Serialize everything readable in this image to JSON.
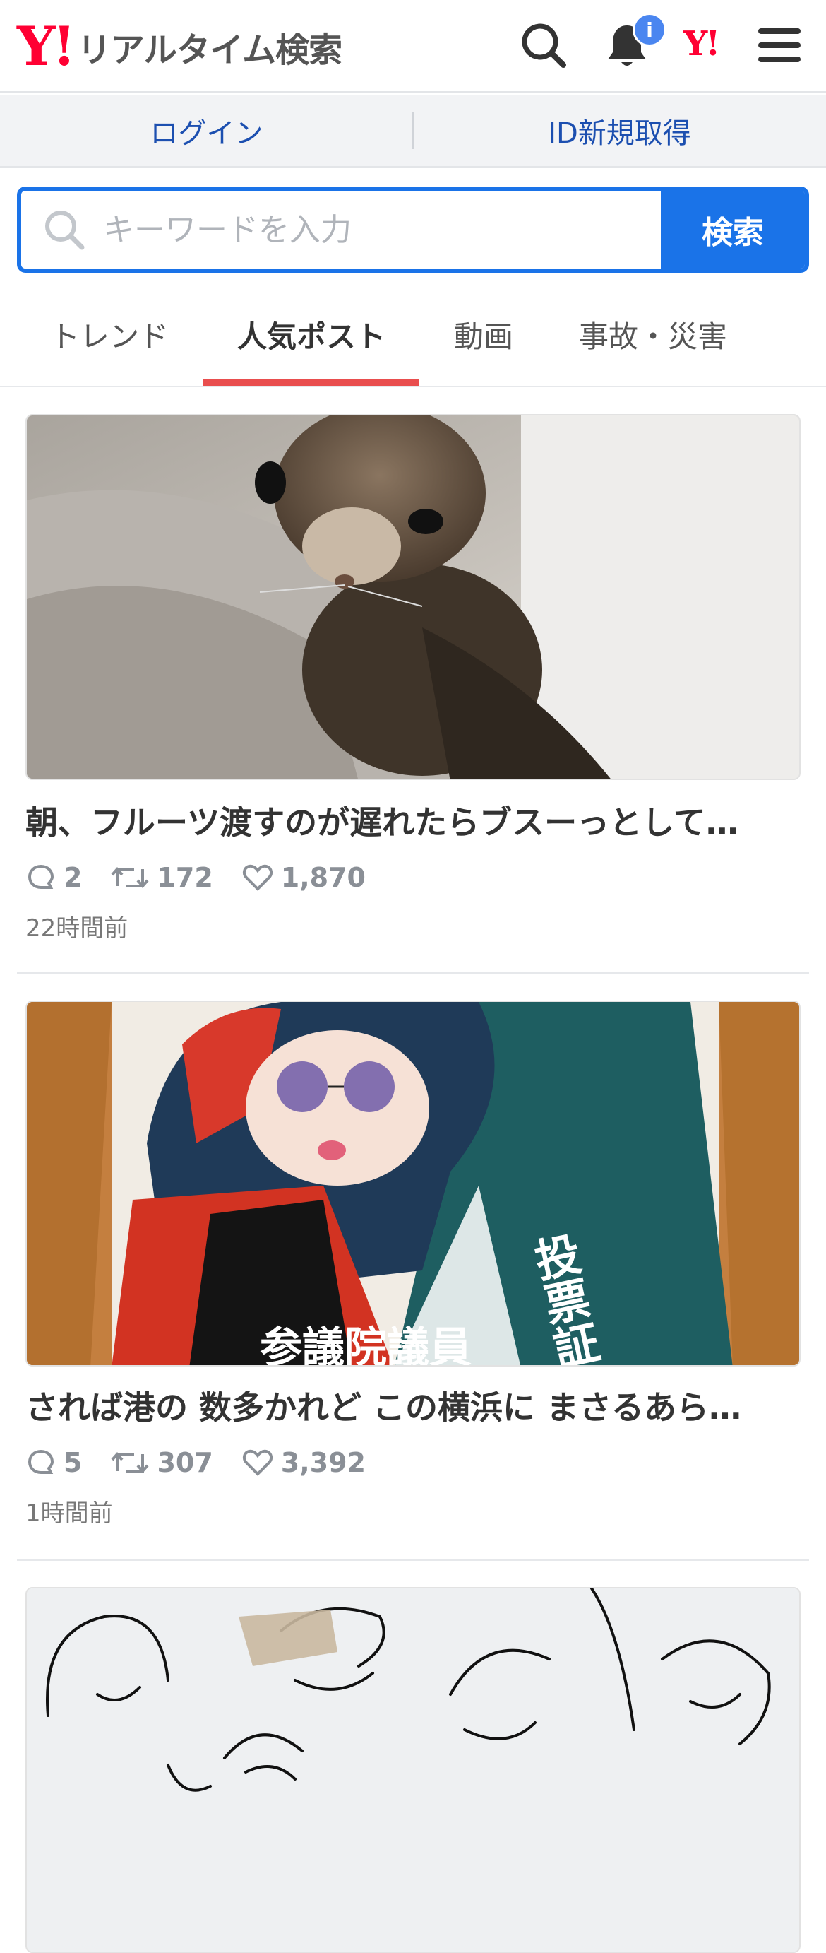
{
  "header": {
    "logo_mark": "Y!",
    "logo_text": "リアルタイム検索",
    "notification_badge": "i",
    "yahoo_mark": "Y!",
    "icons": [
      "search-icon",
      "bell-icon",
      "yahoo-icon",
      "menu-icon"
    ]
  },
  "auth": {
    "login_label": "ログイン",
    "register_label": "ID新規取得"
  },
  "search": {
    "placeholder": "キーワードを入力",
    "button_label": "検索"
  },
  "tabs": [
    {
      "label": "トレンド",
      "active": false
    },
    {
      "label": "人気ポスト",
      "active": true
    },
    {
      "label": "動画",
      "active": false
    },
    {
      "label": "事故・災害",
      "active": false
    }
  ],
  "posts": [
    {
      "title": "朝、フルーツ渡すのが遅れたらブスーっとして…",
      "replies": "2",
      "reposts": "172",
      "likes": "1,870",
      "time": "22時間前"
    },
    {
      "title": "されば港の 数多かれど この横浜に まさるあら…",
      "replies": "5",
      "reposts": "307",
      "likes": "3,392",
      "time": "1時間前",
      "image_text": {
        "right": "投票証",
        "bottom": "参議院議員"
      }
    },
    {
      "title": "",
      "replies": "",
      "reposts": "",
      "likes": "",
      "time": ""
    }
  ],
  "colors": {
    "brand_red": "#ff0033",
    "accent_blue": "#1a73e8",
    "link_blue": "#1c4fb0",
    "tab_underline": "#e94e4e",
    "badge_blue": "#4a86f0"
  }
}
